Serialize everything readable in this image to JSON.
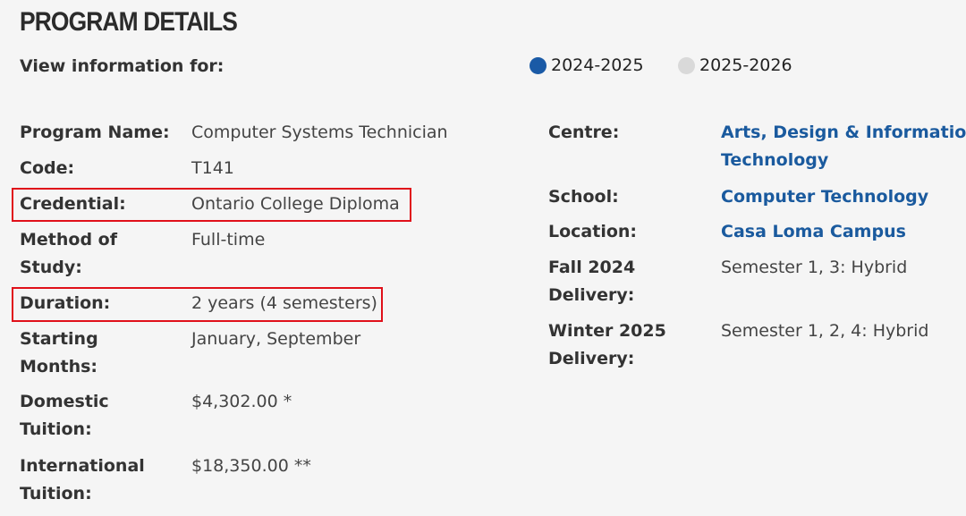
{
  "header": {
    "title": "PROGRAM DETAILS"
  },
  "view": {
    "label": "View information for:",
    "options": [
      {
        "label": "2024-2025",
        "color": "#1a5aa6",
        "selected": true
      },
      {
        "label": "2025-2026",
        "color": "#d9d9d9",
        "selected": false
      }
    ]
  },
  "left": {
    "program_name": {
      "label": "Program Name:",
      "value": "Computer Systems Technician"
    },
    "code": {
      "label": "Code:",
      "value": "T141"
    },
    "credential": {
      "label": "Credential:",
      "value": "Ontario College Diploma"
    },
    "method": {
      "label_1": "Method of",
      "label_2": "Study:",
      "value": "Full-time"
    },
    "duration": {
      "label": "Duration:",
      "value": "2 years (4 semesters)"
    },
    "starting": {
      "label_1": "Starting",
      "label_2": "Months:",
      "value": "January, September"
    },
    "domestic": {
      "label_1": "Domestic",
      "label_2": "Tuition:",
      "value": "$4,302.00 *"
    },
    "international": {
      "label_1": "International",
      "label_2": "Tuition:",
      "value": "$18,350.00 **"
    }
  },
  "right": {
    "centre": {
      "label": "Centre:",
      "value_1": "Arts, Design & Information",
      "value_2": "Technology"
    },
    "school": {
      "label": "School:",
      "value": "Computer Technology"
    },
    "location": {
      "label": "Location:",
      "value": "Casa Loma Campus"
    },
    "fall": {
      "label_1": "Fall 2024",
      "label_2": "Delivery:",
      "value": "Semester 1, 3: Hybrid"
    },
    "winter": {
      "label_1": "Winter 2025",
      "label_2": "Delivery:",
      "value": "Semester 1, 2, 4: Hybrid"
    }
  },
  "colors": {
    "highlight": "#e0101a",
    "link": "#1a5a9e"
  }
}
